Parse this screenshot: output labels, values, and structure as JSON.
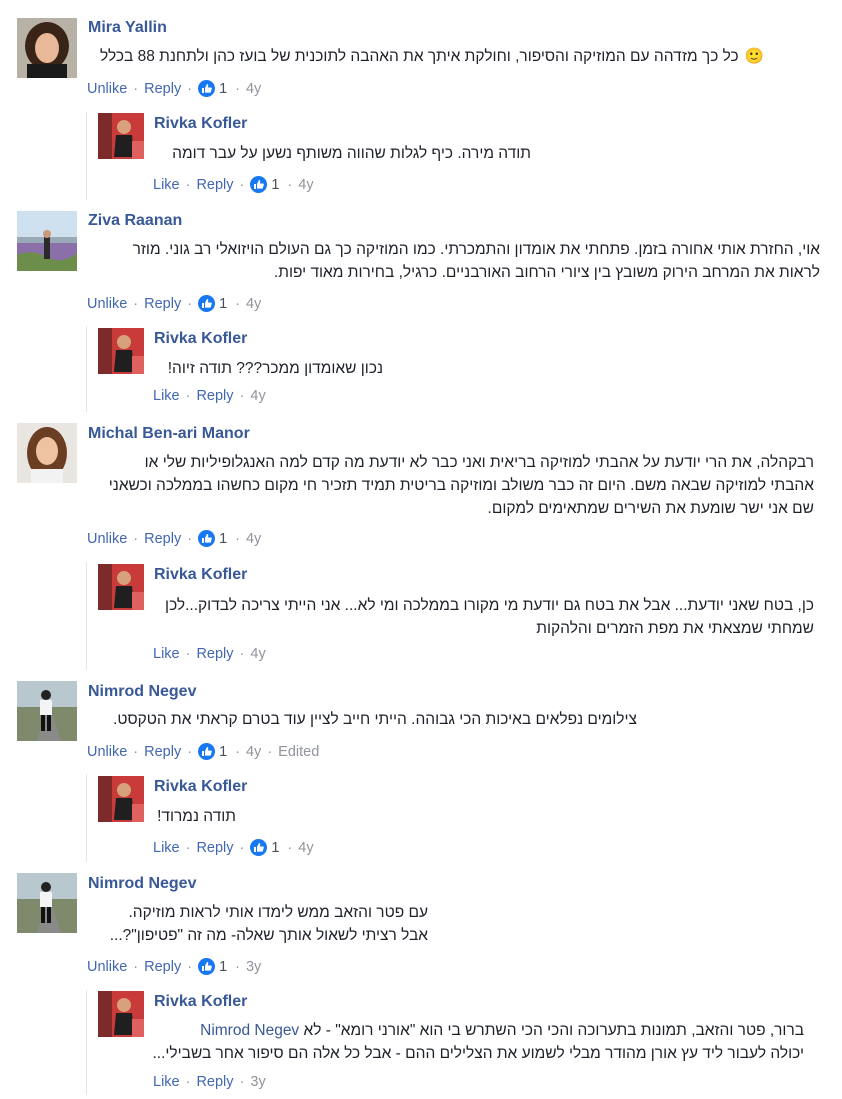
{
  "comments": [
    {
      "author": "Mira Yallin",
      "text_lines": [
        "כל כך מזדהה עם המוזיקה והסיפור, וחולקת איתך את האהבה לתוכנית של בועז כהן ולתחנת 88 בכלל"
      ],
      "emoji": "🙂",
      "unlike": "Unlike",
      "reply": "Reply",
      "likes": "1",
      "time": "4y",
      "reply_comment": {
        "author": "Rivka Kofler",
        "text_lines": [
          "תודה מירה. כיף לגלות שהווה משותף נשען על עבר דומה"
        ],
        "like": "Like",
        "reply": "Reply",
        "likes": "1",
        "time": "4y"
      }
    },
    {
      "author": "Ziva Raanan",
      "text_lines": [
        "אוי, החזרת אותי אחורה בזמן. פתחתי את אומדון והתמכרתי. כמו המוזיקה כך גם העולם הויזואלי רב גוני. מוזר",
        "לראות את המרחב הירוק משובץ בין ציורי הרחוב האורבניים. כרגיל, בחירות מאוד יפות."
      ],
      "unlike": "Unlike",
      "reply": "Reply",
      "likes": "1",
      "time": "4y",
      "reply_comment": {
        "author": "Rivka Kofler",
        "text_lines": [
          "נכון שאומדון ממכר??? תודה זיוה!"
        ],
        "like": "Like",
        "reply": "Reply",
        "time": "4y"
      }
    },
    {
      "author": "Michal Ben-ari Manor",
      "text_lines": [
        "רבקהלה, את הרי יודעת על אהבתי למוזיקה בריאית ואני כבר לא יודעת מה קדם למה האנגלופיליות שלי או",
        "אהבתי למוזיקה שבאה משם. היום זה כבר משולב ומוזיקה בריטית תמיד תזכיר חי מקום כחשהו בממלכה וכשאני",
        "שם אני ישר שומעת את השירים שמתאימים למקום."
      ],
      "unlike": "Unlike",
      "reply": "Reply",
      "likes": "1",
      "time": "4y",
      "reply_comment": {
        "author": "Rivka Kofler",
        "text_lines": [
          "כן, בטח שאני יודעת... אבל את בטח גם יודעת מי מקורו בממלכה ומי לא... אני הייתי צריכה לבדוק...לכן",
          "שמחתי שמצאתי את מפת הזמרים והלהקות"
        ],
        "like": "Like",
        "reply": "Reply",
        "time": "4y"
      }
    },
    {
      "author": "Nimrod Negev",
      "text_lines": [
        "צילומים נפלאים באיכות הכי גבוהה. הייתי חייב לציין עוד בטרם קראתי את הטקסט."
      ],
      "unlike": "Unlike",
      "reply": "Reply",
      "likes": "1",
      "time": "4y",
      "edited": "Edited",
      "reply_comment": {
        "author": "Rivka Kofler",
        "text_lines": [
          "תודה נמרוד!"
        ],
        "like": "Like",
        "reply": "Reply",
        "likes": "1",
        "time": "4y"
      }
    },
    {
      "author": "Nimrod Negev",
      "text_lines": [
        "עם פטר והזאב ממש לימדו אותי לראות מוזיקה.",
        "אבל רציתי לשאול אותך שאלה- מה זה \"פטיפון\"?..."
      ],
      "unlike": "Unlike",
      "reply": "Reply",
      "likes": "1",
      "time": "3y",
      "reply_comment": {
        "author": "Rivka Kofler",
        "mention": "Nimrod Negev",
        "text_lines": [
          "ברור, פטר והזאב, תמונות בתערוכה והכי הכי השתרש בי הוא \"אורני רומא\" - לא",
          "יכולה לעבור ליד עץ אורן מהודר מבלי לשמוע את הצלילים ההם - אבל כל אלה הם סיפור אחר בשבילי..."
        ],
        "like": "Like",
        "reply": "Reply",
        "time": "3y"
      }
    }
  ]
}
